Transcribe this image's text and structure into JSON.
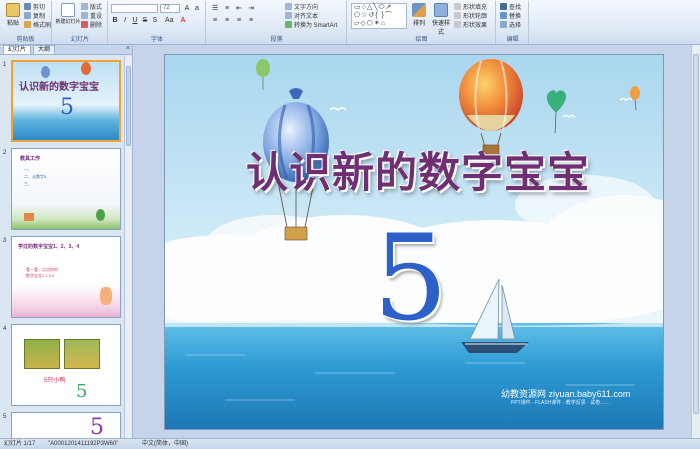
{
  "ribbon": {
    "clipboard": {
      "label": "剪贴板",
      "paste": "粘贴",
      "cut": "剪切",
      "copy": "复制",
      "format_painter": "格式刷"
    },
    "slides": {
      "label": "幻灯片",
      "new_slide": "新建幻灯片",
      "layout": "版式",
      "reset": "重设",
      "delete": "删除"
    },
    "font": {
      "label": "字体",
      "font_size": "72"
    },
    "paragraph": {
      "label": "段落",
      "text_direction": "文字方向",
      "align_text": "对齐文本",
      "smartart": "转换为 SmartArt"
    },
    "drawing": {
      "label": "绘图",
      "arrange": "排列",
      "quick_styles": "快速样式",
      "shape_fill": "形状填充",
      "shape_outline": "形状轮廓",
      "shape_effects": "形状效果"
    },
    "editing": {
      "label": "编辑",
      "find": "查找",
      "replace": "替换",
      "select": "选择"
    }
  },
  "pane": {
    "tab_slides": "幻灯片",
    "tab_outline": "大纲"
  },
  "thumbnails": [
    {
      "num": "1",
      "title": "认识新的数字宝宝",
      "digit": "5"
    },
    {
      "num": "2",
      "heading": "教具工作",
      "lines": [
        "一、",
        "二、认数字5",
        "三、"
      ]
    },
    {
      "num": "3",
      "heading": "学过的数字宝宝1、2、3、4",
      "lines": [
        "看一看，点点你的",
        "数字宝宝1 2 3 4"
      ]
    },
    {
      "num": "4",
      "caption": "5只小鸭",
      "digit": "5"
    },
    {
      "num": "5",
      "digit": "5"
    }
  ],
  "slide": {
    "title": "认识新的数字宝宝",
    "digit": "5",
    "watermark": "幼教资源网 ziyuan.baby611.com",
    "watermark_sub": "PPT课件 · FLASH课件 · 教学反思 · 试卷……"
  },
  "status": {
    "slide_info": "幻灯片 1/17",
    "theme": "\"A0001201411192P3W60\"",
    "language": "中文(简体，中国)"
  },
  "colors": {
    "title": "#6f2f73",
    "digit": "#2d61c8",
    "selected": "#f2a133"
  }
}
